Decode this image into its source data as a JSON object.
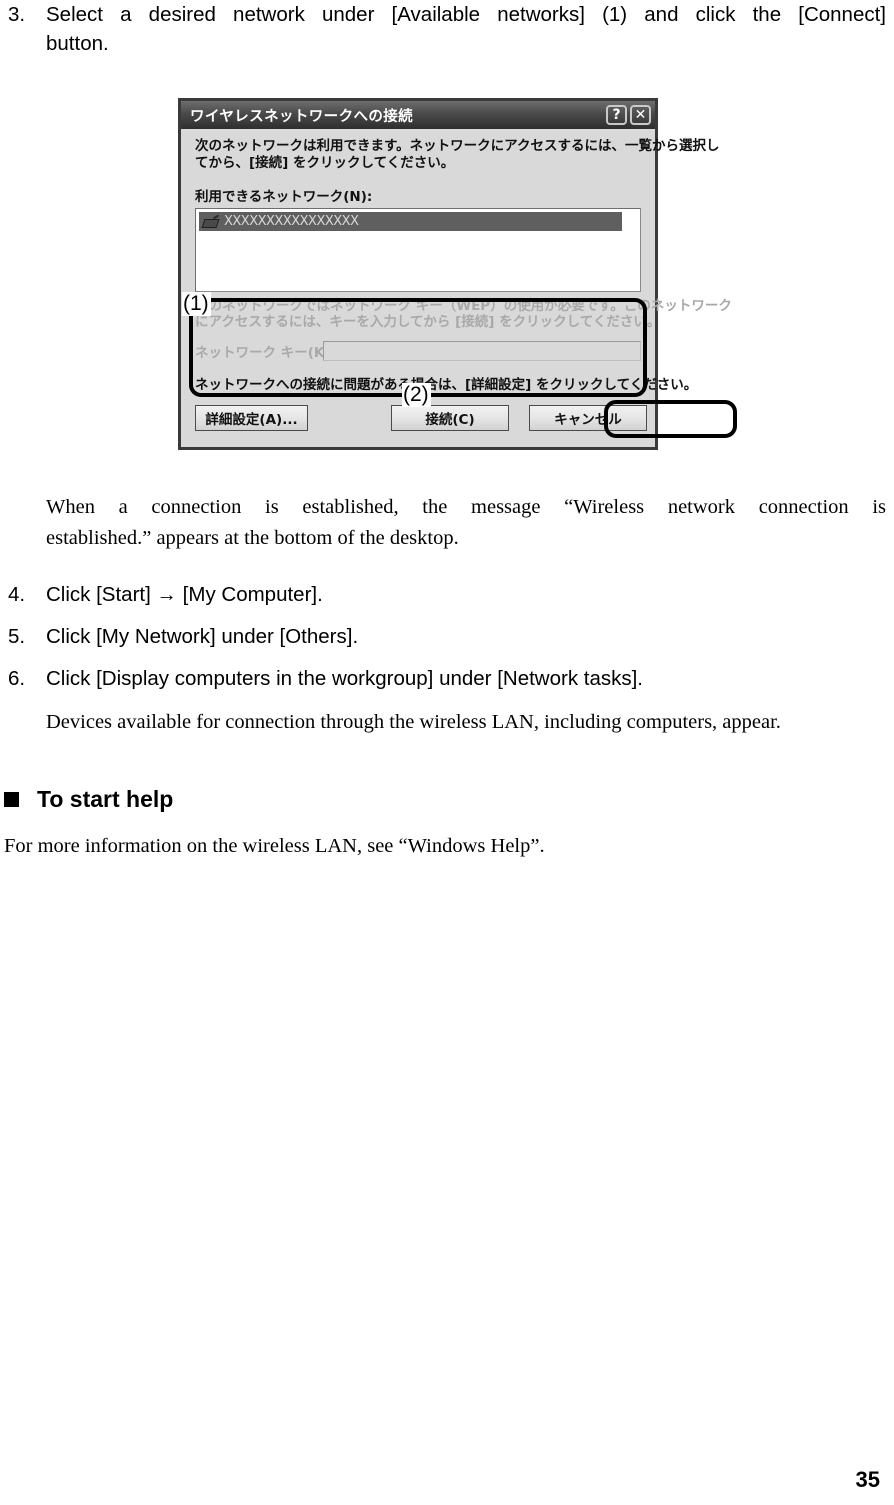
{
  "document": {
    "page_number": "35"
  },
  "steps": [
    {
      "number": "3.",
      "line1": "Select a desired network under [Available networks] (1) and click the [Connect]",
      "line2": "button."
    },
    {
      "number": "4.",
      "text": "Click [Start] → [My Computer]."
    },
    {
      "number": "5.",
      "text": "Click [My Network] under [Others]."
    },
    {
      "number": "6.",
      "text": "Click [Display computers in the workgroup] under [Network tasks]."
    }
  ],
  "paragraphs": {
    "after_dialog_line1": "When a connection is established, the message “Wireless network connection is",
    "after_dialog_line2": "established.” appears at the bottom of the desktop.",
    "after_step6": "Devices available for connection through the wireless LAN, including computers, appear.",
    "help_body": "For more information on the wireless LAN, see “Windows Help”."
  },
  "section": {
    "heading": "To start help"
  },
  "dialog": {
    "title": "ワイヤレスネットワークへの接続",
    "help_button": "?",
    "close_button": "✕",
    "intro_line1": "次のネットワークは利用できます。ネットワークにアクセスするには、一覧から選択し",
    "intro_line2": "てから、[接続] をクリックしてください。",
    "available_networks_label": "利用できるネットワーク(N):",
    "network_list": [
      {
        "icon": "network-adapter-icon",
        "ssid": "XXXXXXXXXXXXXXXX",
        "selected": true
      }
    ],
    "wep_notice_line1": "このネットワークではネットワーク キー（WEP）の使用が必要です。このネットワーク",
    "wep_notice_line2": "にアクセスするには、キーを入力してから [接続] をクリックしてください。",
    "network_key_label": "ネットワーク キー(K):",
    "network_key_value": "",
    "trouble_hint": "ネットワークへの接続に問題がある場合は、[詳細設定] をクリックしてください。",
    "buttons": {
      "advanced": "詳細設定(A)...",
      "connect": "接続(C)",
      "cancel": "キャンセル"
    }
  },
  "callouts": {
    "one": "(1)",
    "two": "(2)"
  },
  "colors": {
    "dialog_face": "#d9d9d9",
    "titlebar_dark": "#2e2e2e",
    "selection": "#5f5f5f",
    "disabled_text": "#a9a9a9",
    "callout_stroke": "#000000"
  }
}
